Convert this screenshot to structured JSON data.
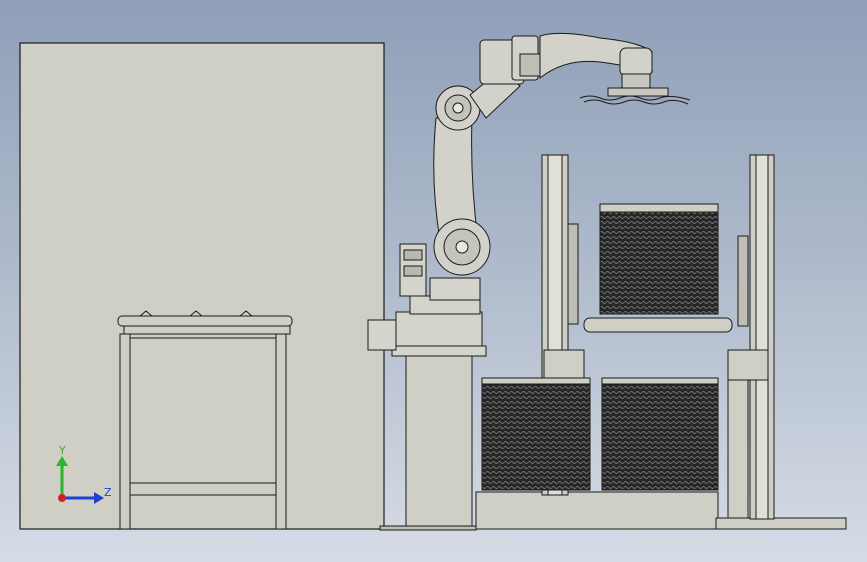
{
  "viewport": {
    "background_top": "#8f9fb8",
    "background_bottom": "#d6dce6"
  },
  "triad": {
    "y_label": "Y",
    "z_label": "Z",
    "y_color": "#2db52d",
    "z_color": "#1f3fd6",
    "origin_color": "#d02020"
  },
  "colors": {
    "part_fill": "#cfcfc6",
    "line": "#1a1a1a",
    "dark_stack": "#2a2a2a"
  },
  "scene": {
    "components": [
      "wall-panel",
      "roller-conveyor",
      "robot-pedestal",
      "industrial-robot-arm",
      "gripper",
      "pallet-rack",
      "stacked-trays",
      "floor-base"
    ]
  }
}
